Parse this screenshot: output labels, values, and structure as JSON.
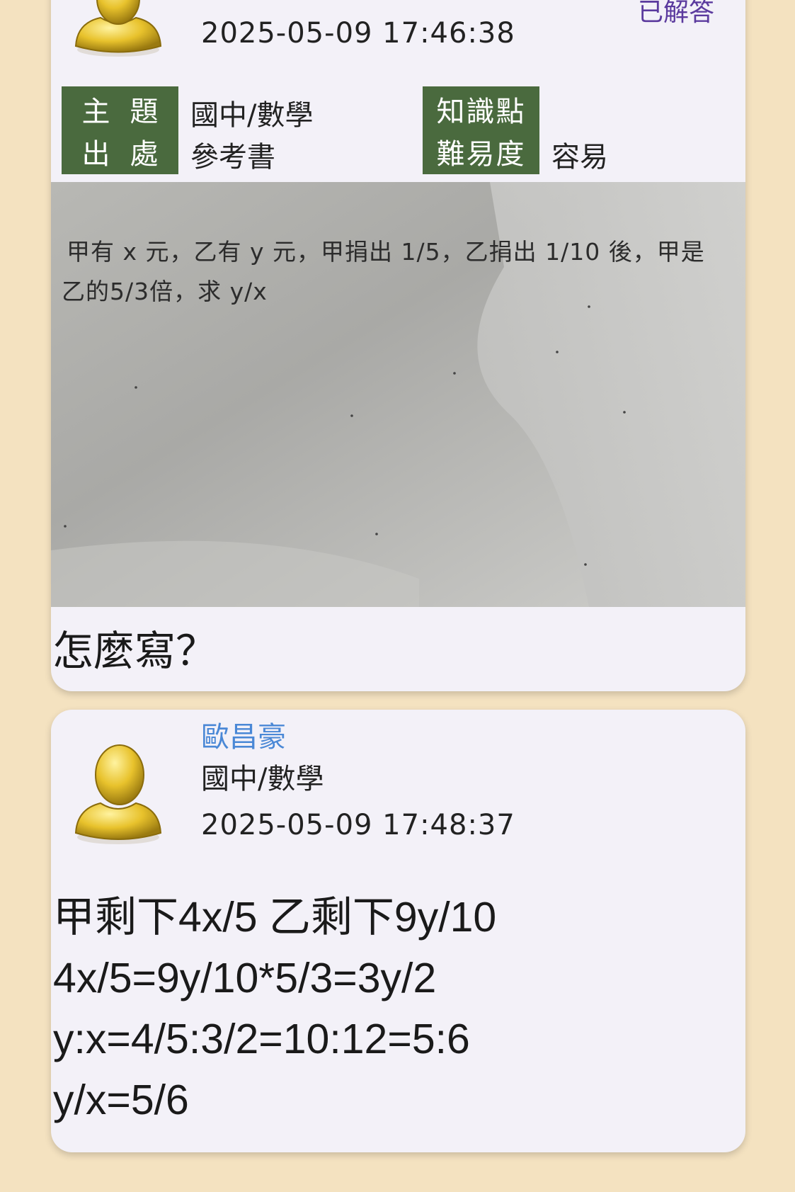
{
  "question_card": {
    "status": "已解答",
    "timestamp": "2025-05-09 17:46:38",
    "labels": {
      "topic": "主題",
      "source": "出處",
      "knowledge_point": "知識點",
      "difficulty": "難易度"
    },
    "values": {
      "topic": "國中/數學",
      "source": "參考書",
      "knowledge_point": "",
      "difficulty": "容易"
    },
    "photo_text": {
      "line1": "甲有 x 元，乙有 y 元，甲捐出 1/5，乙捐出 1/10 後，甲是",
      "line2": "乙的5/3倍，求 y/x"
    },
    "question_text": "怎麼寫？"
  },
  "answer_card": {
    "author_name": "歐昌豪",
    "subject": "國中/數學",
    "timestamp": "2025-05-09 17:48:37",
    "lines": [
      "甲剩下4x/5  乙剩下9y/10",
      "4x/5=9y/10*5/3=3y/2",
      "y:x=4/5:3/2=10:12=5:6",
      "y/x=5/6"
    ]
  },
  "colors": {
    "background": "#f4e2c0",
    "card": "#f3f1f8",
    "label_bg": "#4a6a3e",
    "author": "#4a88d6",
    "status": "#5b3a9e"
  },
  "icons": [
    "user-avatar-icon"
  ]
}
